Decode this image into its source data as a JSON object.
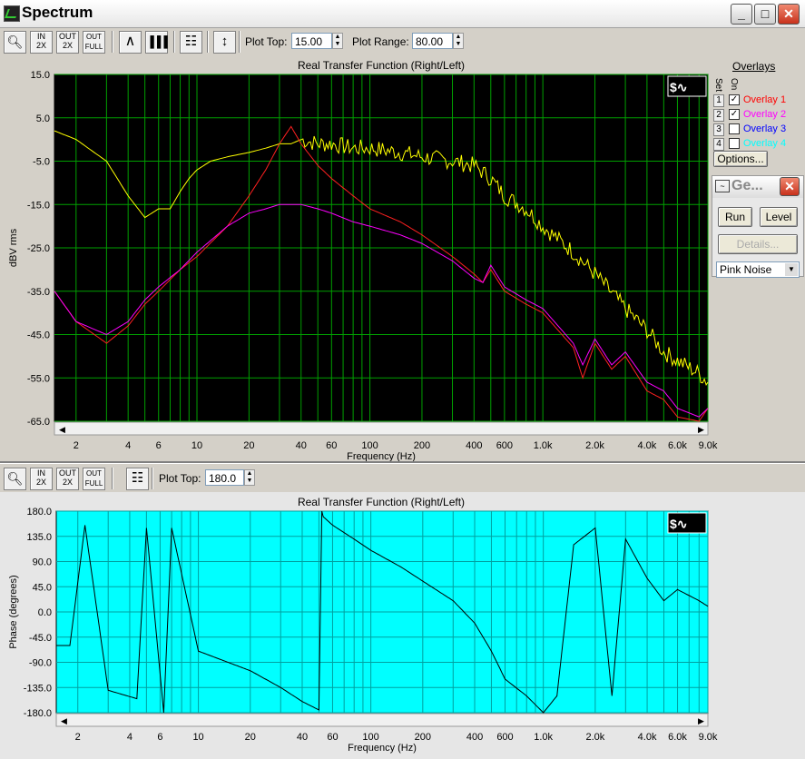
{
  "window": {
    "title": "Spectrum",
    "minimize": "_",
    "maximize": "□",
    "close": "✕"
  },
  "toolbar1": {
    "plot_top_label": "Plot Top:",
    "plot_top_value": "15.00",
    "plot_range_label": "Plot Range:",
    "plot_range_value": "80.00",
    "zoom_in_label": "IN\n2X",
    "zoom_out_label": "OUT\n2X",
    "full_label": "OUT\nFULL"
  },
  "toolbar2": {
    "plot_top_label": "Plot Top:",
    "plot_top_value": "180.0",
    "zoom_in_label": "IN\n2X",
    "zoom_out_label": "OUT\n2X",
    "full_label": "OUT\nFULL"
  },
  "overlays": {
    "header": "Overlays",
    "set_label": "Set",
    "on_label": "On",
    "items": [
      {
        "num": "1",
        "checked": true,
        "name": "Overlay 1",
        "color": "#ff0000"
      },
      {
        "num": "2",
        "checked": true,
        "name": "Overlay 2",
        "color": "#ff00ff"
      },
      {
        "num": "3",
        "checked": false,
        "name": "Overlay 3",
        "color": "#0000ff"
      },
      {
        "num": "4",
        "checked": false,
        "name": "Overlay 4",
        "color": "#00ffff"
      }
    ],
    "options_label": "Options..."
  },
  "generator": {
    "title": "Ge...",
    "run_label": "Run",
    "level_label": "Level",
    "details_label": "Details...",
    "signal_value": "Pink Noise"
  },
  "chart_data": [
    {
      "type": "line",
      "title": "Real Transfer Function (Right/Left)",
      "xlabel": "Frequency (Hz)",
      "ylabel": "dBV rms",
      "xscale": "log",
      "xlim": [
        1.5,
        9000
      ],
      "ylim": [
        -65,
        15
      ],
      "yticks": [
        "15.0",
        "5.0",
        "-5.0",
        "-15.0",
        "-25.0",
        "-35.0",
        "-45.0",
        "-55.0",
        "-65.0"
      ],
      "xticks": [
        "2",
        "4",
        "6",
        "10",
        "20",
        "40",
        "60",
        "100",
        "200",
        "400",
        "600",
        "1.0k",
        "2.0k",
        "4.0k",
        "6.0k",
        "9.0k"
      ],
      "background": "#000000",
      "grid_color": "#00a000",
      "series": [
        {
          "color": "#ffff00",
          "x": [
            1.5,
            2,
            3,
            4,
            5,
            6,
            7,
            8,
            9,
            10,
            12,
            15,
            20,
            25,
            30,
            35,
            40,
            50,
            60,
            80,
            100,
            150,
            200,
            300,
            400,
            500,
            600,
            800,
            1000,
            1500,
            2000,
            3000,
            4000,
            5000,
            6000,
            8000,
            9000
          ],
          "y": [
            2,
            0,
            -5,
            -13,
            -18,
            -16,
            -16,
            -12,
            -9,
            -7,
            -5,
            -4,
            -3,
            -2,
            -1,
            -1,
            0,
            -1,
            -1,
            -2,
            -2,
            -3,
            -4,
            -5,
            -6,
            -9,
            -13,
            -16,
            -20,
            -26,
            -31,
            -39,
            -44,
            -49,
            -51,
            -54,
            -56
          ]
        },
        {
          "color": "#ff2020",
          "x": [
            1.5,
            2,
            3,
            4,
            5,
            6,
            8,
            10,
            15,
            20,
            25,
            30,
            35,
            40,
            50,
            60,
            80,
            100,
            150,
            200,
            300,
            400,
            450,
            500,
            600,
            800,
            1000,
            1500,
            1700,
            2000,
            2500,
            3000,
            4000,
            5000,
            6000,
            8000,
            9000
          ],
          "y": [
            -35,
            -42,
            -47,
            -43,
            -38,
            -35,
            -30,
            -27,
            -20,
            -13,
            -7,
            -1,
            3,
            -1,
            -6,
            -9,
            -13,
            -16,
            -19,
            -22,
            -27,
            -31,
            -33,
            -30,
            -35,
            -38,
            -40,
            -48,
            -55,
            -47,
            -53,
            -50,
            -58,
            -60,
            -64,
            -65,
            -62
          ]
        },
        {
          "color": "#ff00ff",
          "x": [
            1.5,
            2,
            3,
            4,
            5,
            6,
            8,
            10,
            15,
            20,
            25,
            30,
            35,
            40,
            50,
            60,
            80,
            100,
            150,
            200,
            300,
            400,
            450,
            500,
            600,
            800,
            1000,
            1500,
            1700,
            2000,
            2500,
            3000,
            4000,
            5000,
            6000,
            8000,
            9000
          ],
          "y": [
            -35,
            -42,
            -45,
            -42,
            -37,
            -34,
            -30,
            -26,
            -20,
            -17,
            -16,
            -15,
            -15,
            -15,
            -16,
            -17,
            -19,
            -20,
            -22,
            -24,
            -28,
            -32,
            -33,
            -29,
            -34,
            -37,
            -39,
            -47,
            -52,
            -46,
            -52,
            -49,
            -56,
            -58,
            -62,
            -64,
            -62
          ]
        }
      ]
    },
    {
      "type": "line",
      "title": "Real Transfer Function (Right/Left)",
      "xlabel": "Frequency (Hz)",
      "ylabel": "Phase (degrees)",
      "xscale": "log",
      "xlim": [
        1.5,
        9000
      ],
      "ylim": [
        -180,
        180
      ],
      "yticks": [
        "180.0",
        "135.0",
        "90.0",
        "45.0",
        "0.0",
        "-45.0",
        "-90.0",
        "-135.0",
        "-180.0"
      ],
      "xticks": [
        "2",
        "4",
        "6",
        "10",
        "20",
        "40",
        "60",
        "100",
        "200",
        "400",
        "600",
        "1.0k",
        "2.0k",
        "4.0k",
        "6.0k",
        "9.0k"
      ],
      "background": "#00ffff",
      "grid_color": "#00a0a0",
      "series": [
        {
          "color": "#000000",
          "x": [
            1.5,
            1.8,
            2.2,
            3,
            4.4,
            5,
            6.3,
            7,
            10,
            20,
            30,
            40,
            50,
            52,
            53,
            60,
            80,
            100,
            150,
            200,
            300,
            400,
            500,
            600,
            800,
            1000,
            1200,
            1500,
            2000,
            2500,
            3000,
            4000,
            5000,
            6000,
            8000,
            9000
          ],
          "y": [
            -60,
            -60,
            155,
            -140,
            -155,
            150,
            -180,
            150,
            -70,
            -105,
            -135,
            -160,
            -175,
            180,
            170,
            155,
            130,
            110,
            80,
            55,
            20,
            -20,
            -70,
            -120,
            -150,
            -180,
            -150,
            120,
            150,
            -150,
            130,
            60,
            20,
            40,
            20,
            10
          ]
        }
      ]
    }
  ]
}
